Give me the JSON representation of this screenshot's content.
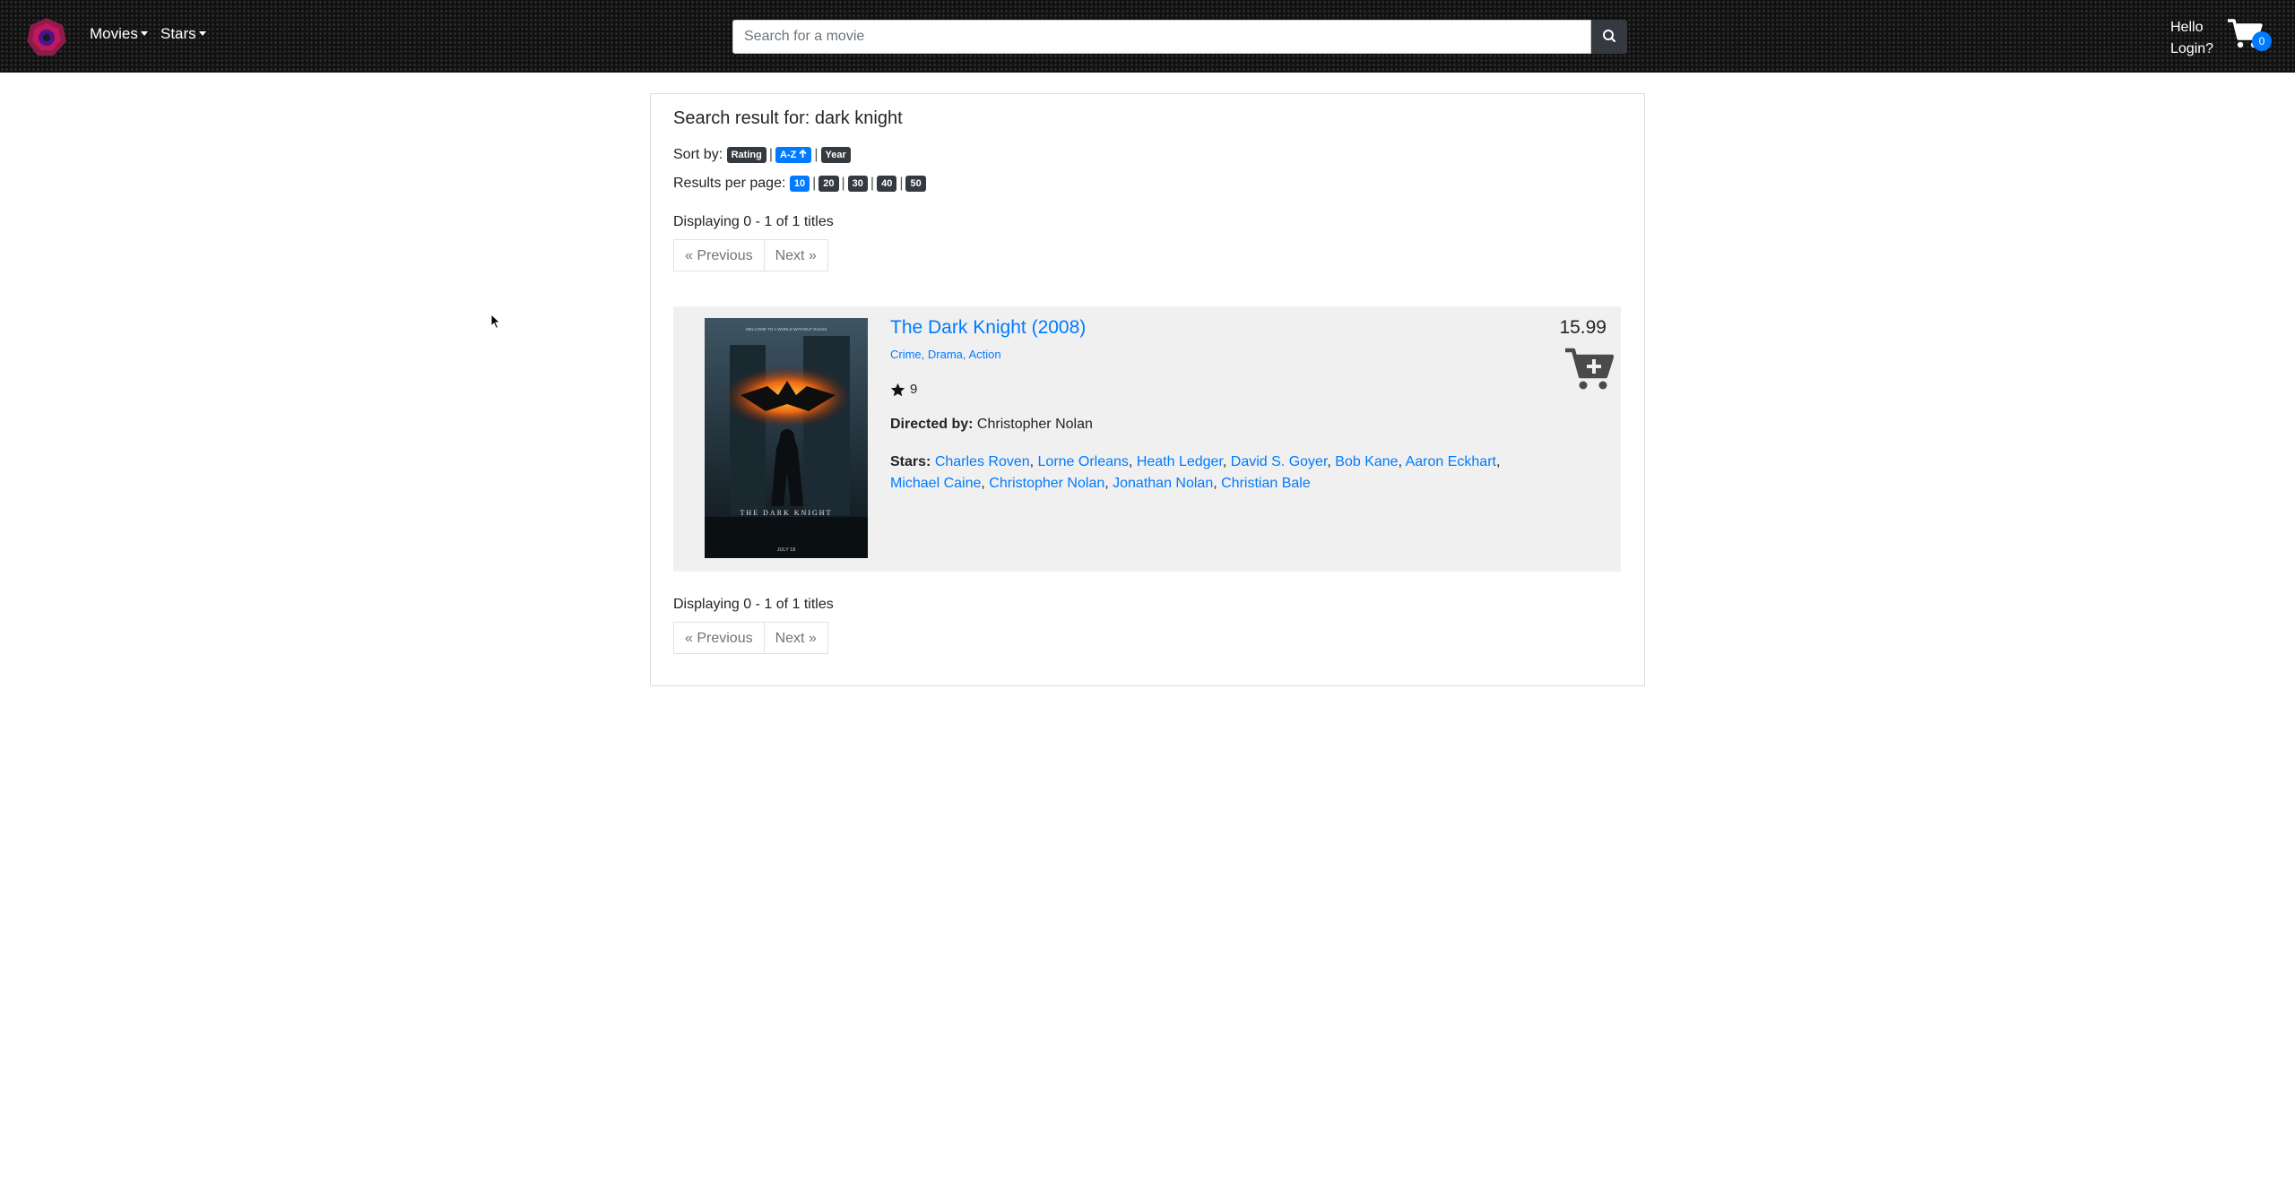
{
  "nav": {
    "movies_label": "Movies",
    "stars_label": "Stars",
    "hello": "Hello",
    "login": "Login?",
    "cart_count": "0"
  },
  "search": {
    "placeholder": "Search for a movie",
    "value": ""
  },
  "results": {
    "heading": "Search result for: dark knight",
    "sort_label": "Sort by:",
    "sort_options": [
      "Rating",
      "A-Z",
      "Year"
    ],
    "sort_active": "A-Z",
    "per_page_label": "Results per page:",
    "per_page_options": [
      "10",
      "20",
      "30",
      "40",
      "50"
    ],
    "per_page_active": "10",
    "display_text": "Displaying 0 - 1 of 1 titles",
    "prev_label": "« Previous",
    "next_label": "Next »"
  },
  "movie": {
    "title": "The Dark Knight (2008)",
    "genres": [
      "Crime",
      "Drama",
      "Action"
    ],
    "rating": "9",
    "directed_label": "Directed by:",
    "director": "Christopher Nolan",
    "stars_label": "Stars:",
    "stars": [
      "Charles Roven",
      "Lorne Orleans",
      "Heath Ledger",
      "David S. Goyer",
      "Bob Kane",
      "Aaron Eckhart",
      "Michael Caine",
      "Christopher Nolan",
      "Jonathan Nolan",
      "Christian Bale"
    ],
    "price": "15.99",
    "poster_tagline": "WELCOME TO A WORLD WITHOUT RULES",
    "poster_title": "THE DARK KNIGHT",
    "poster_date": "JULY 18"
  },
  "colors": {
    "link": "#007bff",
    "badge_dark": "#343a40",
    "result_bg": "#f0f0f0"
  }
}
